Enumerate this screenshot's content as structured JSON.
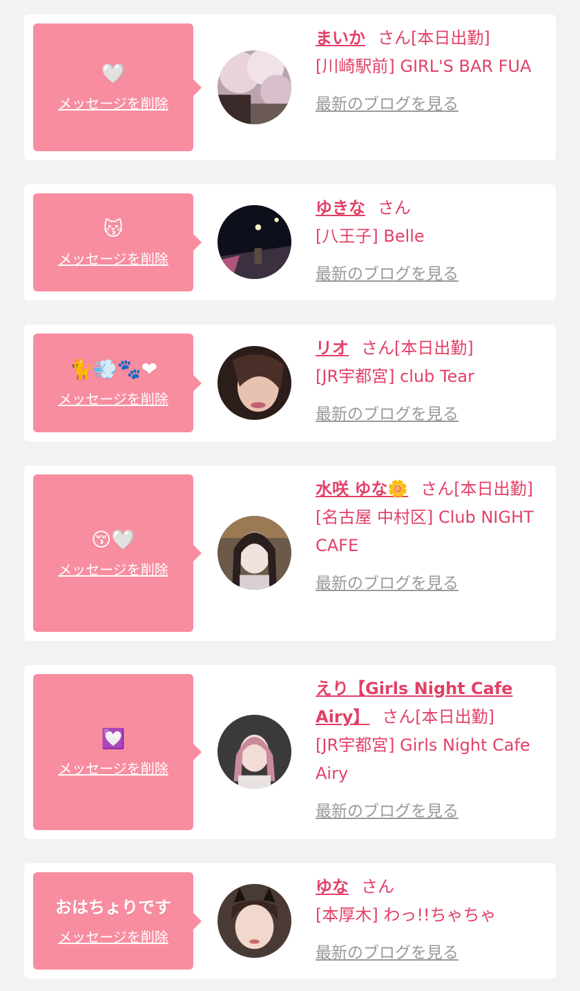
{
  "delete_label": "メッセージを削除",
  "blog_label": "最新のブログを見る",
  "san_label": "さん",
  "colors": {
    "background": "#f2f2f2",
    "bubble": "#f88da0",
    "accent": "#e24066",
    "link_gray": "#999999"
  },
  "items": [
    {
      "message": "🤍",
      "name": "まいか",
      "status": "[本日出勤]",
      "shop": "[川崎駅前] GIRL'S BAR FUA",
      "avatar_icon": "cherry-blossom-photo"
    },
    {
      "message": "😽",
      "name": "ゆきな",
      "status": "",
      "shop": "[八王子] Belle",
      "avatar_icon": "night-street-photo"
    },
    {
      "message": "🐈💨🐾❤",
      "name": "リオ",
      "status": "[本日出勤]",
      "shop": "[JR宇都宮] club Tear",
      "avatar_icon": "selfie-photo"
    },
    {
      "message": "😚🤍",
      "name": "水咲 ゆな🌼",
      "status": "[本日出勤]",
      "shop": "[名古屋 中村区] Club NIGHT CAFE",
      "avatar_icon": "portrait-photo"
    },
    {
      "message": "💟",
      "name": "えり【Girls Night Cafe Airy】",
      "status": "[本日出勤]",
      "shop": "[JR宇都宮] Girls Night Cafe Airy",
      "avatar_icon": "pink-hair-photo"
    },
    {
      "message": "おはちょりです",
      "name": "ゆな",
      "status": "",
      "shop": "[本厚木] わっ!!ちゃちゃ",
      "avatar_icon": "cat-ears-selfie-photo"
    }
  ]
}
